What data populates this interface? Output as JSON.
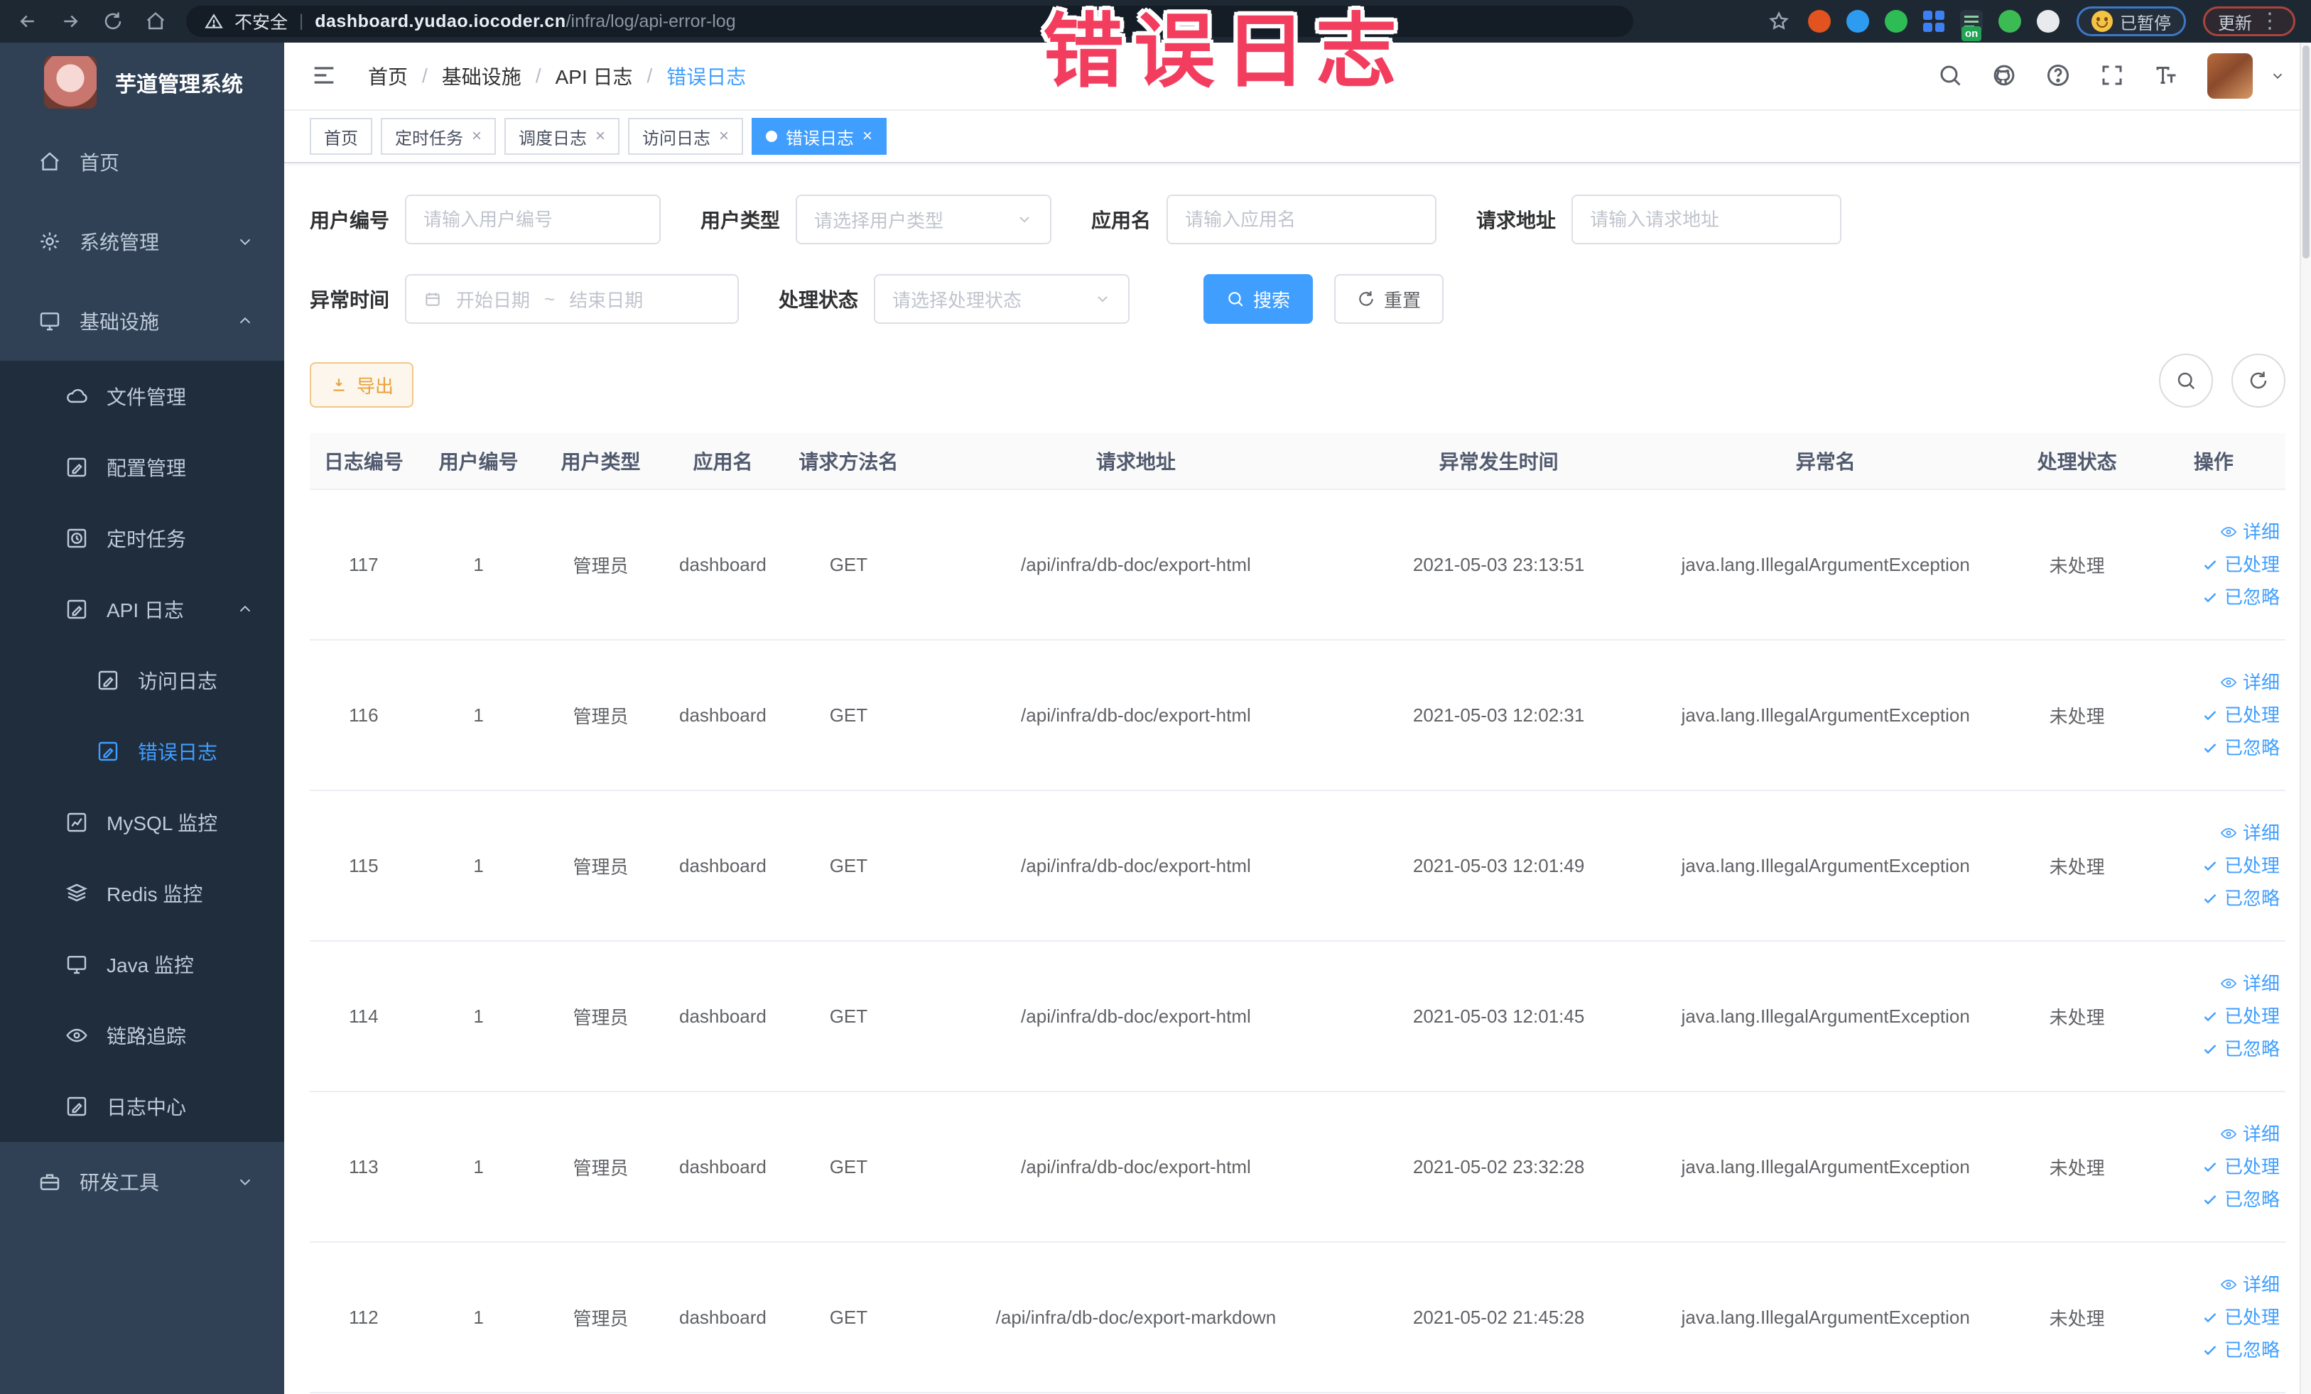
{
  "annotation": {
    "text": "错误日志",
    "color": "#f33d5e"
  },
  "colors": {
    "accent": "#409eff",
    "warning": "#e6a23c",
    "sidebar_bg": "#304156",
    "sidebar_sub_bg": "#1f2d3d"
  },
  "browser": {
    "security_label": "不安全",
    "url_host": "dashboard.yudao.iocoder.cn",
    "url_path": "/infra/log/api-error-log",
    "paused_badge": "已暂停",
    "update_badge": "更新",
    "on_badge": "on",
    "extensions": [
      {
        "name": "ublock-extension-icon",
        "shape": "circle",
        "color": "#e2531f"
      },
      {
        "name": "drop-extension-icon",
        "shape": "circle",
        "color": "#2d9cf0"
      },
      {
        "name": "green-extension-icon",
        "shape": "circle",
        "color": "#2dbd54"
      },
      {
        "name": "grid-extension-icon",
        "shape": "grid",
        "color": "#3d7ff5"
      },
      {
        "name": "dark-lines-extension-icon",
        "shape": "lines",
        "color": "#2a3440",
        "badge": "on"
      },
      {
        "name": "sprout-extension-icon",
        "shape": "circle",
        "color": "#3cba54"
      },
      {
        "name": "puzzle-extension-icon",
        "shape": "circle",
        "color": "#e8eaed"
      }
    ]
  },
  "sidebar": {
    "app_title": "芋道管理系统",
    "items": [
      {
        "key": "home",
        "label": "首页",
        "icon": "home-icon",
        "level": 1
      },
      {
        "key": "system-management",
        "label": "系统管理",
        "icon": "gear-icon",
        "level": 1,
        "chevron": "down"
      },
      {
        "key": "infrastructure",
        "label": "基础设施",
        "icon": "monitor-icon",
        "level": 1,
        "chevron": "up"
      },
      {
        "key": "file-management",
        "label": "文件管理",
        "icon": "cloud-icon",
        "level": 2
      },
      {
        "key": "config-management",
        "label": "配置管理",
        "icon": "edit-square-icon",
        "level": 2
      },
      {
        "key": "scheduled-jobs",
        "label": "定时任务",
        "icon": "clock-square-icon",
        "level": 2
      },
      {
        "key": "api-log",
        "label": "API 日志",
        "icon": "doc-edit-icon",
        "level": 2,
        "chevron": "up"
      },
      {
        "key": "access-log",
        "label": "访问日志",
        "icon": "doc-edit-icon",
        "level": 3
      },
      {
        "key": "error-log",
        "label": "错误日志",
        "icon": "doc-edit-icon",
        "level": 3,
        "active": true
      },
      {
        "key": "mysql-monitor",
        "label": "MySQL 监控",
        "icon": "chart-icon",
        "level": 2
      },
      {
        "key": "redis-monitor",
        "label": "Redis 监控",
        "icon": "layers-icon",
        "level": 2
      },
      {
        "key": "java-monitor",
        "label": "Java 监控",
        "icon": "monitor-icon",
        "level": 2
      },
      {
        "key": "trace",
        "label": "链路追踪",
        "icon": "eye-icon",
        "level": 2
      },
      {
        "key": "log-center",
        "label": "日志中心",
        "icon": "doc-edit-icon",
        "level": 2
      },
      {
        "key": "dev-tools",
        "label": "研发工具",
        "icon": "briefcase-icon",
        "level": 1,
        "chevron": "down"
      }
    ]
  },
  "header": {
    "breadcrumb": [
      "首页",
      "基础设施",
      "API 日志",
      "错误日志"
    ]
  },
  "tabs": [
    {
      "label": "首页",
      "closable": false,
      "active": false
    },
    {
      "label": "定时任务",
      "closable": true,
      "active": false
    },
    {
      "label": "调度日志",
      "closable": true,
      "active": false
    },
    {
      "label": "访问日志",
      "closable": true,
      "active": false
    },
    {
      "label": "错误日志",
      "closable": true,
      "active": true
    }
  ],
  "filters": {
    "user_id": {
      "label": "用户编号",
      "placeholder": "请输入用户编号"
    },
    "user_type": {
      "label": "用户类型",
      "placeholder": "请选择用户类型"
    },
    "app_name": {
      "label": "应用名",
      "placeholder": "请输入应用名"
    },
    "request_url": {
      "label": "请求地址",
      "placeholder": "请输入请求地址"
    },
    "exception_time": {
      "label": "异常时间",
      "start_placeholder": "开始日期",
      "separator": "~",
      "end_placeholder": "结束日期"
    },
    "process_status": {
      "label": "处理状态",
      "placeholder": "请选择处理状态"
    },
    "search_label": "搜索",
    "reset_label": "重置"
  },
  "toolbar": {
    "export_label": "导出"
  },
  "table": {
    "columns": [
      "日志编号",
      "用户编号",
      "用户类型",
      "应用名",
      "请求方法名",
      "请求地址",
      "异常发生时间",
      "异常名",
      "处理状态",
      "操作"
    ],
    "row_actions": [
      "详细",
      "已处理",
      "已忽略"
    ],
    "rows": [
      {
        "id": "117",
        "user_id": "1",
        "user_type": "管理员",
        "app_name": "dashboard",
        "method": "GET",
        "url": "/api/infra/db-doc/export-html",
        "time": "2021-05-03 23:13:51",
        "exception": "java.lang.IllegalArgumentException",
        "status": "未处理"
      },
      {
        "id": "116",
        "user_id": "1",
        "user_type": "管理员",
        "app_name": "dashboard",
        "method": "GET",
        "url": "/api/infra/db-doc/export-html",
        "time": "2021-05-03 12:02:31",
        "exception": "java.lang.IllegalArgumentException",
        "status": "未处理"
      },
      {
        "id": "115",
        "user_id": "1",
        "user_type": "管理员",
        "app_name": "dashboard",
        "method": "GET",
        "url": "/api/infra/db-doc/export-html",
        "time": "2021-05-03 12:01:49",
        "exception": "java.lang.IllegalArgumentException",
        "status": "未处理"
      },
      {
        "id": "114",
        "user_id": "1",
        "user_type": "管理员",
        "app_name": "dashboard",
        "method": "GET",
        "url": "/api/infra/db-doc/export-html",
        "time": "2021-05-03 12:01:45",
        "exception": "java.lang.IllegalArgumentException",
        "status": "未处理"
      },
      {
        "id": "113",
        "user_id": "1",
        "user_type": "管理员",
        "app_name": "dashboard",
        "method": "GET",
        "url": "/api/infra/db-doc/export-html",
        "time": "2021-05-02 23:32:28",
        "exception": "java.lang.IllegalArgumentException",
        "status": "未处理"
      },
      {
        "id": "112",
        "user_id": "1",
        "user_type": "管理员",
        "app_name": "dashboard",
        "method": "GET",
        "url": "/api/infra/db-doc/export-markdown",
        "time": "2021-05-02 21:45:28",
        "exception": "java.lang.IllegalArgumentException",
        "status": "未处理"
      }
    ]
  }
}
